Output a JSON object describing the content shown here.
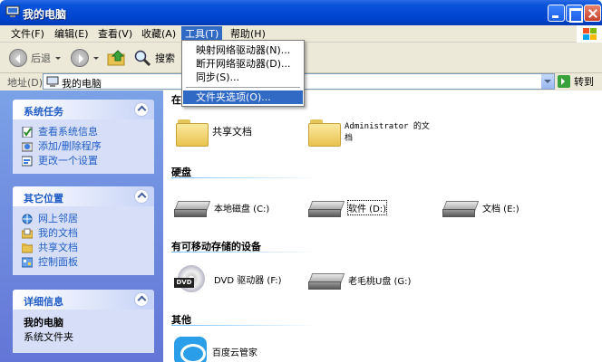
{
  "window": {
    "title": "我的电脑",
    "buttons": {
      "minimize": "minimize",
      "maximize": "maximize",
      "close": "close"
    }
  },
  "menubar": {
    "items": [
      {
        "label": "文件(F)"
      },
      {
        "label": "编辑(E)"
      },
      {
        "label": "查看(V)"
      },
      {
        "label": "收藏(A)"
      },
      {
        "label": "工具(T)",
        "active": true
      },
      {
        "label": "帮助(H)"
      }
    ]
  },
  "tools_menu": {
    "items": [
      {
        "label": "映射网络驱动器(N)..."
      },
      {
        "label": "断开网络驱动器(D)..."
      },
      {
        "label": "同步(S)..."
      },
      {
        "label": "文件夹选项(O)...",
        "highlighted": true
      }
    ]
  },
  "toolbar": {
    "back_label": "后退",
    "search_label": "搜索"
  },
  "addressbar": {
    "label": "地址(D)",
    "value": "我的电脑",
    "go_label": "转到"
  },
  "sidebar": {
    "system_tasks": {
      "title": "系统任务",
      "items": [
        {
          "label": "查看系统信息",
          "icon": "info-icon"
        },
        {
          "label": "添加/删除程序",
          "icon": "programs-icon"
        },
        {
          "label": "更改一个设置",
          "icon": "settings-icon"
        }
      ]
    },
    "other_places": {
      "title": "其它位置",
      "items": [
        {
          "label": "网上邻居",
          "icon": "network-icon"
        },
        {
          "label": "我的文档",
          "icon": "documents-icon"
        },
        {
          "label": "共享文档",
          "icon": "folder-icon"
        },
        {
          "label": "控制面板",
          "icon": "control-panel-icon"
        }
      ]
    },
    "details": {
      "title": "详细信息",
      "name": "我的电脑",
      "type": "系统文件夹"
    }
  },
  "main": {
    "sections": {
      "stored": "在",
      "hard_disks": "硬盘",
      "removable": "有可移动存储的设备",
      "other": "其他"
    },
    "folders": [
      {
        "label": "共享文档"
      },
      {
        "label": "Administrator 的文档"
      }
    ],
    "drives": [
      {
        "label": "本地磁盘 (C:)"
      },
      {
        "label": "软件 (D:)",
        "selected": true
      },
      {
        "label": "文档 (E:)"
      }
    ],
    "removable": [
      {
        "label": "DVD 驱动器 (F:)",
        "badge": "DVD"
      },
      {
        "label": "老毛桃U盘 (G:)"
      }
    ],
    "other": [
      {
        "label": "百度云管家"
      }
    ]
  }
}
